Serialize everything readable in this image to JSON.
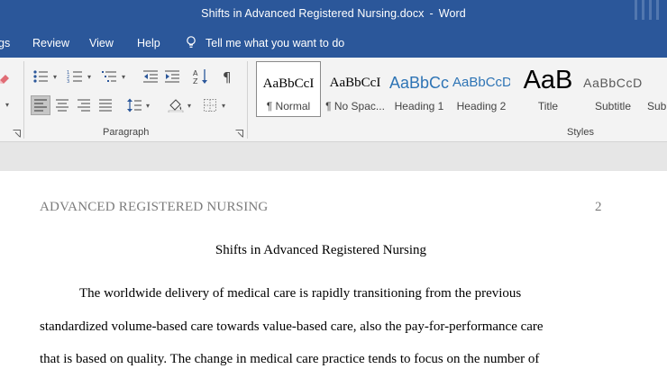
{
  "window": {
    "doc_name": "Shifts in Advanced Registered Nursing.docx",
    "separator": "-",
    "app_name": "Word"
  },
  "tabs": [
    {
      "label": "gs"
    },
    {
      "label": "Review"
    },
    {
      "label": "View"
    },
    {
      "label": "Help"
    }
  ],
  "tell_me": {
    "label": "Tell me what you want to do",
    "icon": "lightbulb-icon"
  },
  "paragraph_group": {
    "label": "Paragraph",
    "icons": [
      "bullets-icon",
      "numbering-icon",
      "multilevel-list-icon",
      "decrease-indent-icon",
      "increase-indent-icon",
      "sort-icon",
      "show-marks-icon",
      "align-left-icon",
      "center-icon",
      "align-right-icon",
      "justify-icon",
      "line-spacing-icon",
      "shading-icon",
      "borders-icon"
    ]
  },
  "styles_group": {
    "label": "Styles",
    "items": [
      {
        "preview": "AaBbCcI",
        "name": "¶ Normal",
        "selected": true
      },
      {
        "preview": "AaBbCcI",
        "name": "¶ No Spac..."
      },
      {
        "preview": "AaBbCc",
        "name": "Heading 1"
      },
      {
        "preview": "AaBbCcD",
        "name": "Heading 2"
      },
      {
        "preview": "AaB",
        "name": "Title"
      },
      {
        "preview": "AaBbCcD",
        "name": "Subtitle"
      },
      {
        "preview": "",
        "name": "Sub"
      }
    ],
    "colors": {
      "heading": "#2e74b5",
      "title": "#000000",
      "subtitle": "#595959"
    }
  },
  "document": {
    "running_head": "ADVANCED REGISTERED NURSING",
    "page_number": "2",
    "title": "Shifts in Advanced Registered Nursing",
    "lines": [
      "The worldwide delivery of medical care is rapidly transitioning from the previous",
      "standardized volume-based care towards value-based care, also the pay-for-performance care",
      "that is based on quality. The change in medical care practice tends to focus on the number of"
    ]
  },
  "colors": {
    "titlebar": "#2b579a",
    "ribbon": "#f3f3f3",
    "canvas": "#e6e6e6",
    "page": "#ffffff"
  }
}
